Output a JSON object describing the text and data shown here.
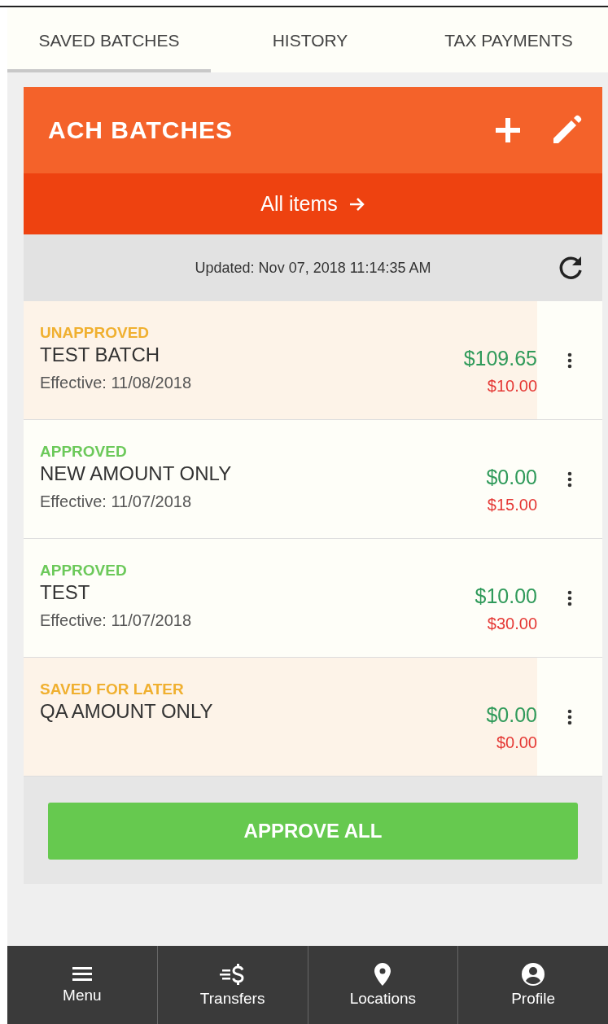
{
  "tabs": [
    {
      "label": "SAVED BATCHES",
      "selected": true
    },
    {
      "label": "HISTORY",
      "selected": false
    },
    {
      "label": "TAX PAYMENTS",
      "selected": false
    }
  ],
  "card": {
    "title": "ACH BATCHES",
    "all_items": "All items",
    "updated": "Updated: Nov 07, 2018 11:14:35 AM"
  },
  "batches": [
    {
      "status": "UNAPPROVED",
      "kind": "unapproved",
      "name": "TEST BATCH",
      "effective": "Effective: 11/08/2018",
      "amount": "$109.65",
      "debit": "$10.00"
    },
    {
      "status": "APPROVED",
      "kind": "approved",
      "name": "NEW AMOUNT ONLY",
      "effective": "Effective: 11/07/2018",
      "amount": "$0.00",
      "debit": "$15.00"
    },
    {
      "status": "APPROVED",
      "kind": "approved",
      "name": "TEST",
      "effective": "Effective: 11/07/2018",
      "amount": "$10.00",
      "debit": "$30.00"
    },
    {
      "status": "SAVED FOR LATER",
      "kind": "saved",
      "name": "QA AMOUNT ONLY",
      "amount": "$0.00",
      "debit": "$0.00"
    }
  ],
  "approve_button": "APPROVE ALL",
  "bottom_nav": [
    {
      "label": "Menu",
      "kind": "menu"
    },
    {
      "label": "Transfers",
      "kind": "transfers"
    },
    {
      "label": "Locations",
      "kind": "locations"
    },
    {
      "label": "Profile",
      "kind": "profile"
    }
  ]
}
